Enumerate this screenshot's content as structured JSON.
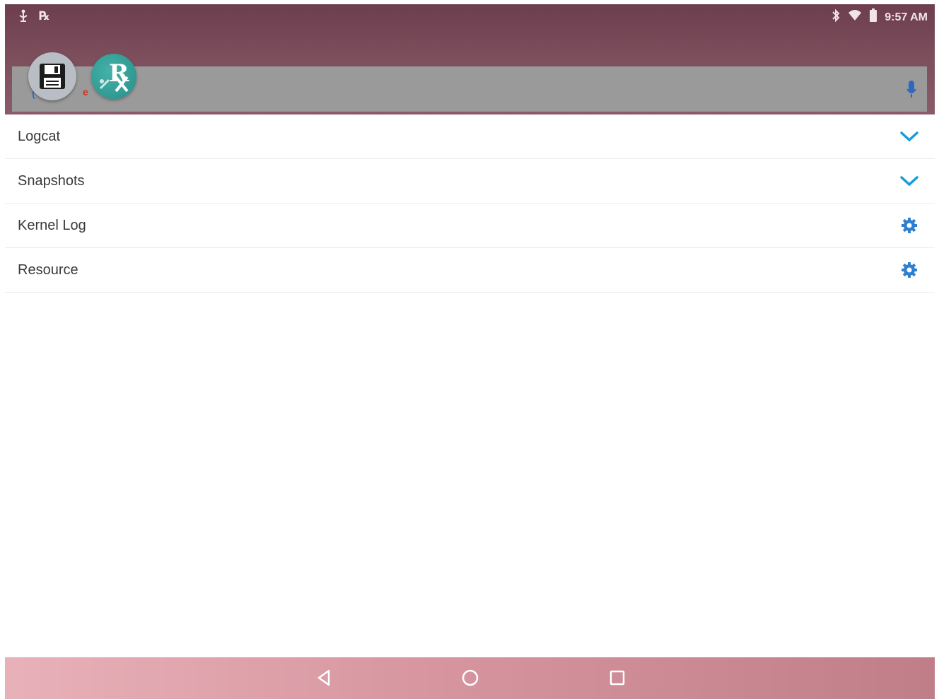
{
  "status_bar": {
    "time": "9:57 AM",
    "left_icons": [
      "usb-debug-icon",
      "rx-notification-icon"
    ],
    "right_icons": [
      "bluetooth-icon",
      "wifi-icon",
      "battery-icon"
    ]
  },
  "search": {
    "icons": [
      "save-icon",
      "rx-icon",
      "mic-icon"
    ]
  },
  "list": {
    "items": [
      {
        "label": "Logcat",
        "icon": "chevron-down-icon"
      },
      {
        "label": "Snapshots",
        "icon": "chevron-down-icon"
      },
      {
        "label": "Kernel Log",
        "icon": "gear-icon"
      },
      {
        "label": "Resource",
        "icon": "gear-icon"
      }
    ]
  },
  "nav_bar": {
    "buttons": [
      "back-icon",
      "home-icon",
      "recents-icon"
    ]
  },
  "colors": {
    "accent": "#2f7fd1",
    "chevron": "#1a9bdc",
    "header": "#7c4e5c",
    "search_bar": "#9a9a9a",
    "nav_bar": "#d5939d"
  }
}
